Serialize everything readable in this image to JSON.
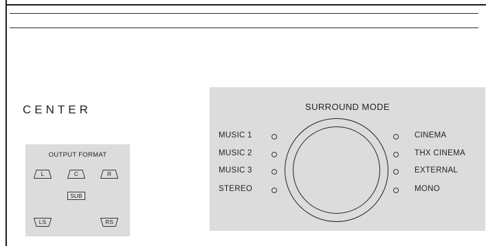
{
  "page": {
    "section_title": "CENTER"
  },
  "output_format": {
    "title": "OUTPUT FORMAT",
    "speakers": {
      "left": "L",
      "center": "C",
      "right": "R",
      "subwoofer": "SUB",
      "left_surround": "LS",
      "right_surround": "RS"
    }
  },
  "surround_mode": {
    "title": "SURROUND MODE",
    "left_modes": [
      "MUSIC 1",
      "MUSIC 2",
      "MUSIC 3",
      "STEREO"
    ],
    "right_modes": [
      "CINEMA",
      "THX CINEMA",
      "EXTERNAL",
      "MONO"
    ],
    "knob_icon": "rotary-knob"
  },
  "colors": {
    "panel_background": "#dcdcdc",
    "line": "#1a1a1a"
  }
}
